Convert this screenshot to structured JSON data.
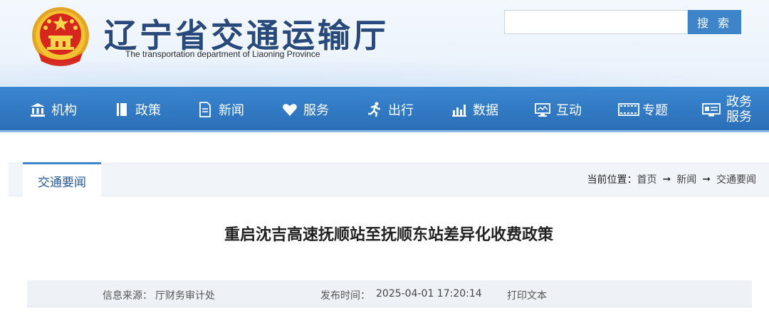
{
  "header": {
    "site_title": "辽宁省交通运输厅",
    "site_subtitle": "The transportation department of Liaoning Province",
    "emblem_icon": "national-emblem-icon"
  },
  "search": {
    "value": "",
    "placeholder": "",
    "button_label": "搜 索"
  },
  "nav": {
    "items": [
      {
        "label": "机构",
        "icon": "institution-icon"
      },
      {
        "label": "政策",
        "icon": "book-icon"
      },
      {
        "label": "新闻",
        "icon": "document-icon"
      },
      {
        "label": "服务",
        "icon": "heart-icon"
      },
      {
        "label": "出行",
        "icon": "running-icon"
      },
      {
        "label": "数据",
        "icon": "bar-chart-icon"
      },
      {
        "label": "互动",
        "icon": "monitor-icon"
      },
      {
        "label": "专题",
        "icon": "film-icon"
      },
      {
        "label_line1": "政务",
        "label_line2": "服务",
        "icon": "gov-service-icon"
      }
    ]
  },
  "tab": {
    "active_label": "交通要闻"
  },
  "breadcrumb": {
    "label": "当前位置：",
    "items": [
      "首页",
      "新闻",
      "交通要闻"
    ],
    "separator": "➞"
  },
  "article": {
    "title": "重启沈吉高速抚顺站至抚顺东站差异化收费政策",
    "source_label": "信息来源：",
    "source": "厅财务审计处",
    "time_label": "发布时间：",
    "time": "2025-04-01 17:20:14",
    "print_label": "打印文本"
  },
  "colors": {
    "nav_bg": "#2f7cc4",
    "title_blue": "#27497b",
    "search_button": "#3e84c8",
    "emblem_red": "#d7261e",
    "emblem_gold": "#f2c230"
  }
}
